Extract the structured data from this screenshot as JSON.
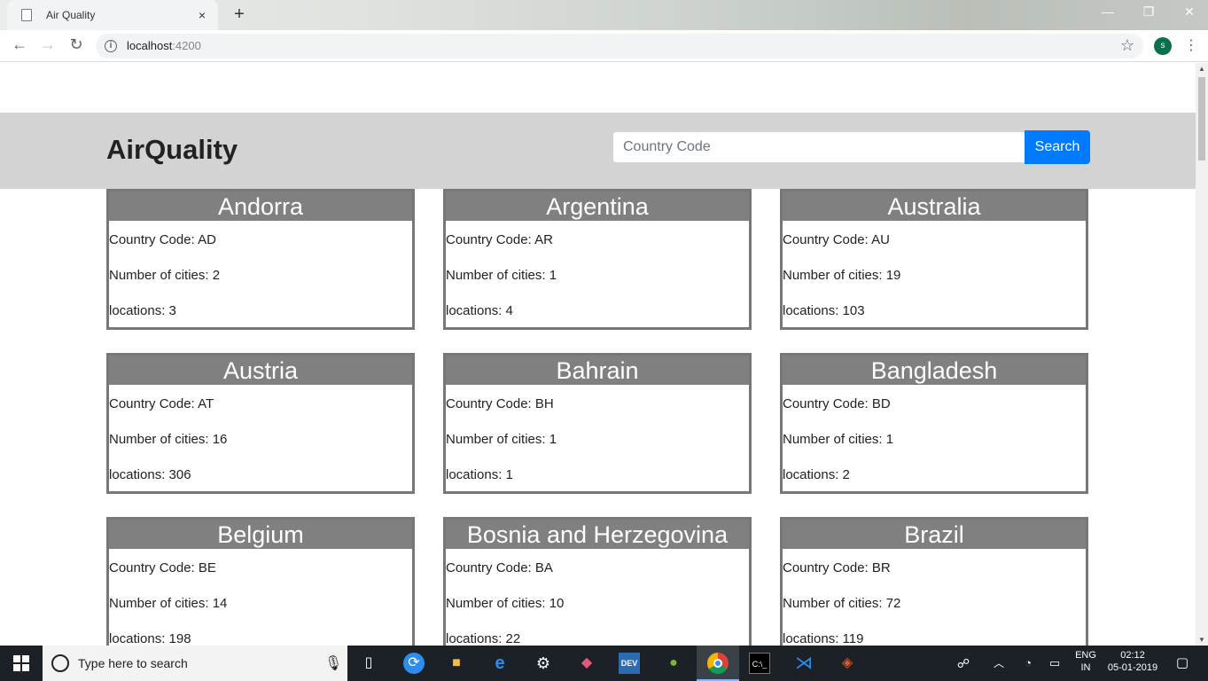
{
  "browser": {
    "tab_title": "Air Quality",
    "close_glyph": "×",
    "new_tab_glyph": "+",
    "url_host": "localhost",
    "url_port": ":4200",
    "avatar_initial": "s",
    "win_min": "—",
    "win_restore": "❐",
    "win_close": "✕",
    "back_glyph": "←",
    "forward_glyph": "→",
    "reload_glyph": "↻",
    "star_glyph": "☆",
    "menu_glyph": "⋮"
  },
  "app": {
    "brand": "AirQuality",
    "search_placeholder": "Country Code",
    "search_button": "Search",
    "labels": {
      "code": "Country Code: ",
      "cities": "Number of cities: ",
      "locations": "locations: "
    },
    "countries": [
      {
        "name": "Andorra",
        "code": "AD",
        "cities": "2",
        "locations": "3"
      },
      {
        "name": "Argentina",
        "code": "AR",
        "cities": "1",
        "locations": "4"
      },
      {
        "name": "Australia",
        "code": "AU",
        "cities": "19",
        "locations": "103"
      },
      {
        "name": "Austria",
        "code": "AT",
        "cities": "16",
        "locations": "306"
      },
      {
        "name": "Bahrain",
        "code": "BH",
        "cities": "1",
        "locations": "1"
      },
      {
        "name": "Bangladesh",
        "code": "BD",
        "cities": "1",
        "locations": "2"
      },
      {
        "name": "Belgium",
        "code": "BE",
        "cities": "14",
        "locations": "198"
      },
      {
        "name": "Bosnia and Herzegovina",
        "code": "BA",
        "cities": "10",
        "locations": "22"
      },
      {
        "name": "Brazil",
        "code": "BR",
        "cities": "72",
        "locations": "119"
      }
    ]
  },
  "taskbar": {
    "search_text": "Type here to search",
    "lang_top": "ENG",
    "lang_bottom": "IN",
    "time": "02:12",
    "date": "05-01-2019",
    "dev_label": "DEV"
  }
}
